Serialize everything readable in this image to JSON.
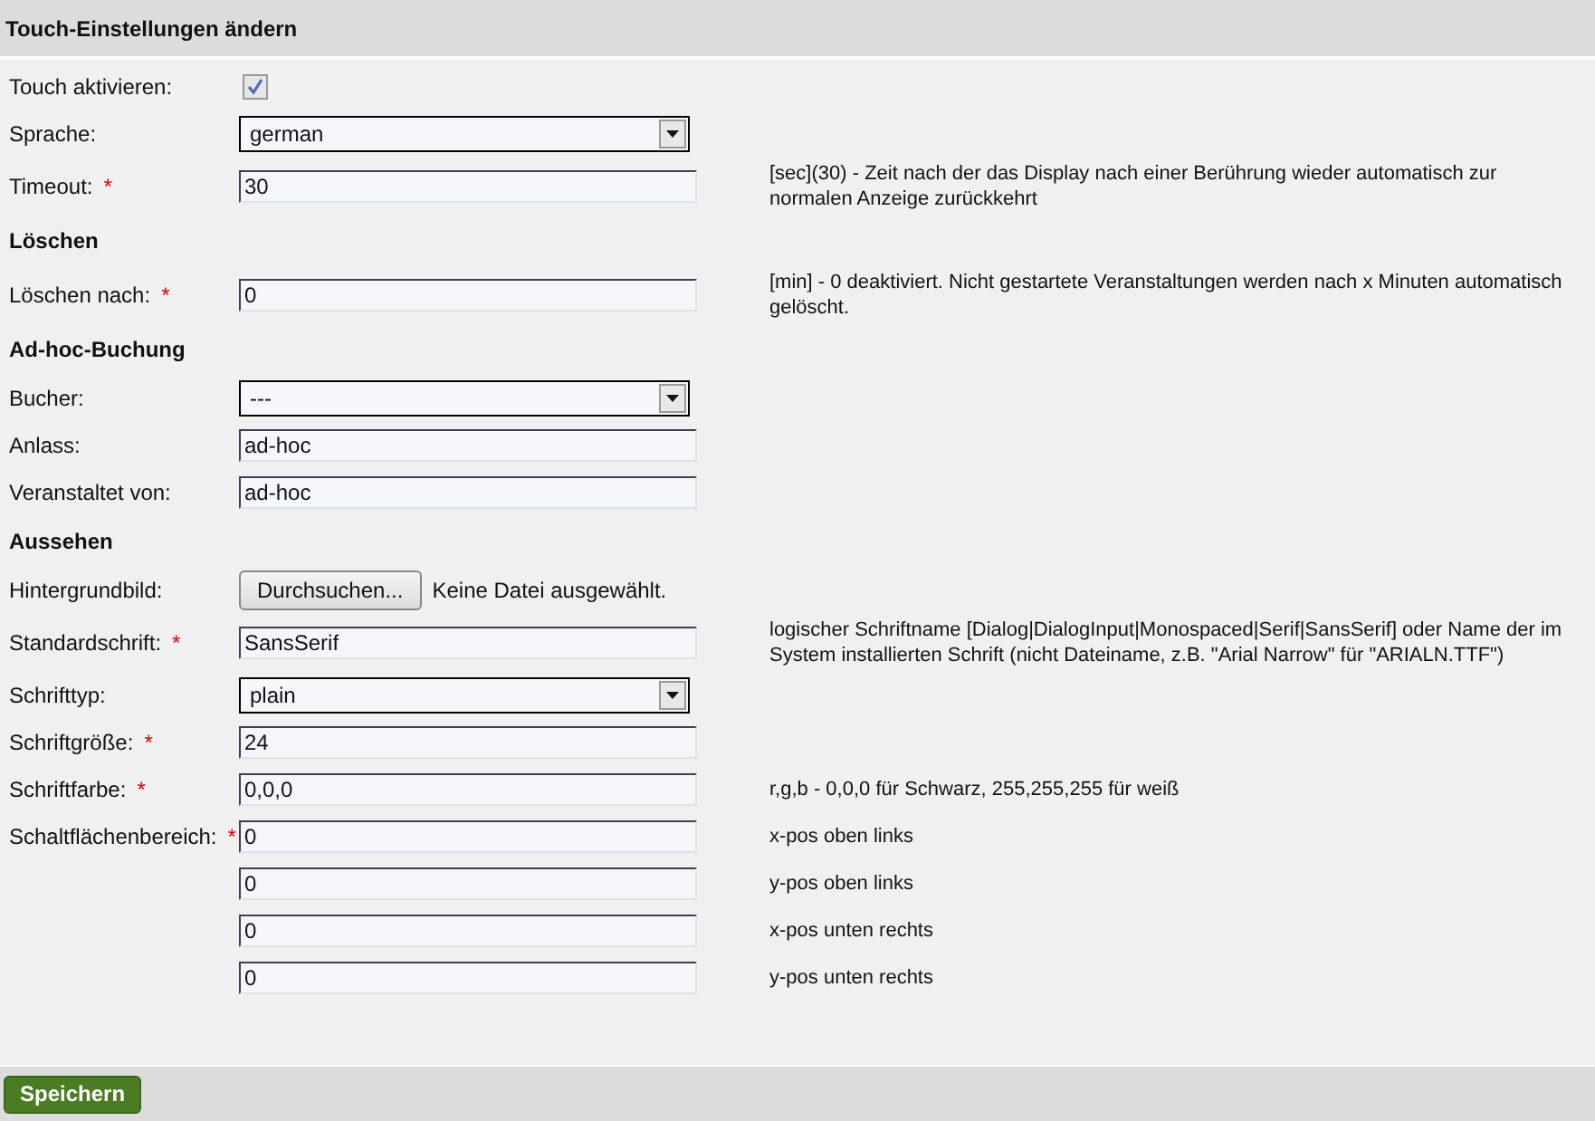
{
  "title": "Touch-Einstellungen ändern",
  "rows": [
    {
      "kind": "checkbox",
      "label": "Touch aktivieren:",
      "checked": true
    },
    {
      "kind": "select",
      "label": "Sprache:",
      "value": "german"
    },
    {
      "kind": "text",
      "label": "Timeout:",
      "required_mark": "*",
      "value": "30",
      "hint": "[sec](30) - Zeit nach der das Display nach einer Berührung wieder automatisch zur normalen Anzeige zurückkehrt"
    },
    {
      "kind": "heading",
      "label": "Löschen"
    },
    {
      "kind": "text",
      "label": "Löschen nach:",
      "required_mark": "*",
      "value": "0",
      "hint": "[min] - 0 deaktiviert. Nicht gestartete Veranstaltungen werden nach x Minuten automatisch gelöscht."
    },
    {
      "kind": "heading",
      "label": "Ad-hoc-Buchung"
    },
    {
      "kind": "select",
      "label": "Bucher:",
      "value": "---"
    },
    {
      "kind": "text",
      "label": "Anlass:",
      "value": "ad-hoc"
    },
    {
      "kind": "text",
      "label": "Veranstaltet von:",
      "value": "ad-hoc"
    },
    {
      "kind": "heading",
      "label": "Aussehen"
    },
    {
      "kind": "file",
      "label": "Hintergrundbild:",
      "button": "Durchsuchen...",
      "status": "Keine Datei ausgewählt."
    },
    {
      "kind": "text",
      "label": "Standardschrift:",
      "required_mark": "*",
      "value": "SansSerif",
      "hint": "logischer Schriftname [Dialog|DialogInput|Monospaced|Serif|SansSerif] oder Name der im System installierten Schrift (nicht Dateiname, z.B. \"Arial Narrow\" für \"ARIALN.TTF\")"
    },
    {
      "kind": "select",
      "label": "Schrifttyp:",
      "value": "plain"
    },
    {
      "kind": "text",
      "label": "Schriftgröße:",
      "required_mark": "*",
      "value": "24"
    },
    {
      "kind": "text",
      "label": "Schriftfarbe:",
      "required_mark": "*",
      "value": "0,0,0",
      "hint": "r,g,b - 0,0,0 für Schwarz, 255,255,255 für weiß"
    },
    {
      "kind": "text",
      "label": "Schaltflächenbereich:",
      "required_mark": "*",
      "value": "0",
      "hint": "x-pos oben links"
    },
    {
      "kind": "text",
      "value": "0",
      "hint": "y-pos oben links"
    },
    {
      "kind": "text",
      "value": "0",
      "hint": "x-pos unten rechts"
    },
    {
      "kind": "text",
      "value": "0",
      "hint": "y-pos unten rechts"
    }
  ],
  "save_button": "Speichern"
}
